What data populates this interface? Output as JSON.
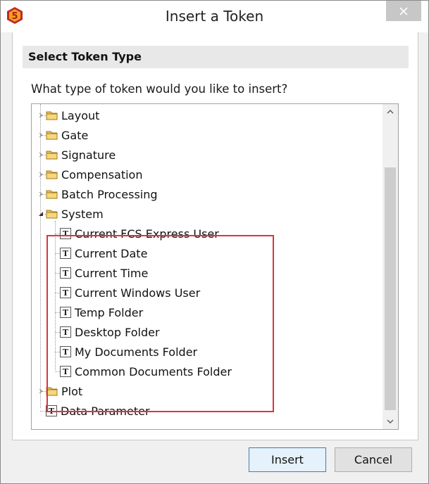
{
  "window": {
    "title": "Insert a Token"
  },
  "section": {
    "title": "Select Token Type"
  },
  "question": "What type of token would you like to insert?",
  "tree": {
    "items": [
      {
        "label": "Layout",
        "type": "folder"
      },
      {
        "label": "Gate",
        "type": "folder"
      },
      {
        "label": "Signature",
        "type": "folder"
      },
      {
        "label": "Compensation",
        "type": "folder"
      },
      {
        "label": "Batch Processing",
        "type": "folder"
      },
      {
        "label": "System",
        "type": "folder",
        "expanded": true
      },
      {
        "label": "Current FCS Express User",
        "type": "token"
      },
      {
        "label": "Current Date",
        "type": "token"
      },
      {
        "label": "Current Time",
        "type": "token"
      },
      {
        "label": "Current Windows User",
        "type": "token"
      },
      {
        "label": "Temp Folder",
        "type": "token"
      },
      {
        "label": "Desktop Folder",
        "type": "token"
      },
      {
        "label": "My Documents Folder",
        "type": "token"
      },
      {
        "label": "Common Documents Folder",
        "type": "token"
      },
      {
        "label": "Plot",
        "type": "folder"
      },
      {
        "label": "Data Parameter",
        "type": "token"
      }
    ]
  },
  "buttons": {
    "insert": "Insert",
    "cancel": "Cancel"
  },
  "colors": {
    "highlight": "#d9363e",
    "folder": "#e8c15a",
    "accent": "#3c7fb1"
  },
  "icons": {
    "close": "close-icon",
    "folder": "folder-icon",
    "token": "text-token-icon",
    "app": "fcs-express-logo-icon"
  }
}
